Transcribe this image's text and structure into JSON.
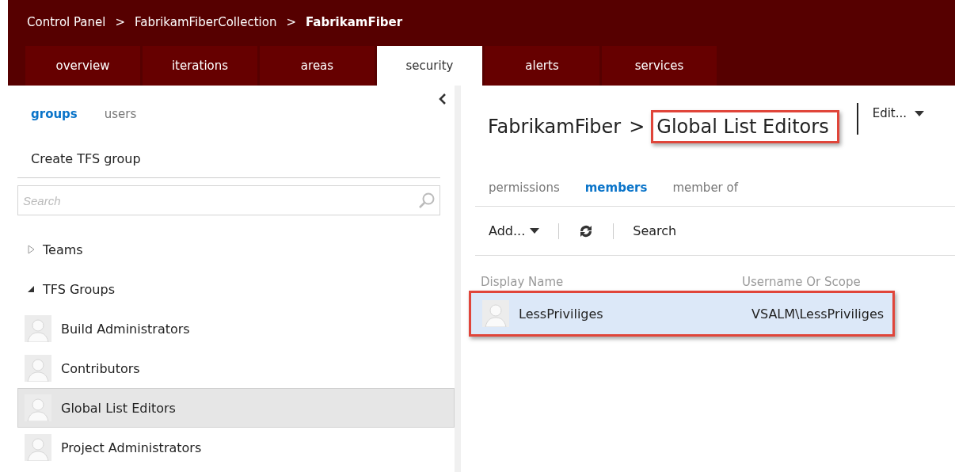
{
  "breadcrumb": [
    {
      "label": "Control Panel",
      "current": false
    },
    {
      "label": "FabrikamFiberCollection",
      "current": false
    },
    {
      "label": "FabrikamFiber",
      "current": true
    }
  ],
  "breadcrumb_separator": ">",
  "tabs": [
    {
      "label": "overview",
      "selected": false
    },
    {
      "label": "iterations",
      "selected": false
    },
    {
      "label": "areas",
      "selected": false
    },
    {
      "label": "security",
      "selected": true
    },
    {
      "label": "alerts",
      "selected": false
    },
    {
      "label": "services",
      "selected": false
    }
  ],
  "sidebar": {
    "pivots": [
      {
        "label": "groups",
        "selected": true
      },
      {
        "label": "users",
        "selected": false
      }
    ],
    "create_link": "Create TFS group",
    "search": {
      "placeholder": "Search"
    },
    "tree": [
      {
        "label": "Teams",
        "expanded": false
      },
      {
        "label": "TFS Groups",
        "expanded": true,
        "children": [
          {
            "label": "Build Administrators",
            "selected": false
          },
          {
            "label": "Contributors",
            "selected": false
          },
          {
            "label": "Global List Editors",
            "selected": true
          },
          {
            "label": "Project Administrators",
            "selected": false
          }
        ]
      }
    ]
  },
  "detail": {
    "parent": "FabrikamFiber",
    "separator": ">",
    "title": "Global List Editors",
    "title_highlighted": true,
    "edit_menu": "Edit...",
    "pivots": [
      {
        "label": "permissions",
        "selected": false
      },
      {
        "label": "members",
        "selected": true
      },
      {
        "label": "member of",
        "selected": false
      }
    ],
    "toolbar": {
      "add": "Add...",
      "search": "Search"
    },
    "table": {
      "columns": [
        "Display Name",
        "Username Or Scope"
      ],
      "rows": [
        {
          "display_name": "LessPriviliges",
          "username": "VSALM\\LessPriviliges",
          "selected": true,
          "highlighted": true
        }
      ]
    }
  }
}
